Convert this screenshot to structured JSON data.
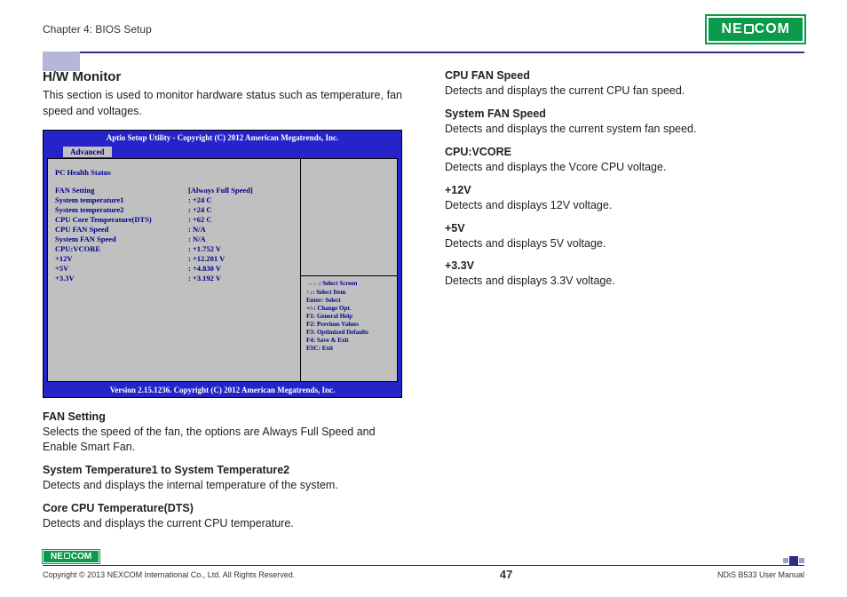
{
  "header": {
    "chapter": "Chapter 4: BIOS Setup",
    "logo_text_pre": "NE",
    "logo_text_post": "COM"
  },
  "left": {
    "title": "H/W Monitor",
    "intro": "This section is used to monitor hardware status such as temperature, fan speed and voltages.",
    "fan_setting": {
      "title": "FAN Setting",
      "desc": "Selects the speed of the fan, the options are Always Full Speed and Enable Smart Fan."
    },
    "systemp": {
      "title": "System Temperature1 to System Temperature2",
      "desc": "Detects and displays the internal temperature of the system."
    },
    "core": {
      "title": "Core CPU Temperature(DTS)",
      "desc": "Detects and displays the current CPU temperature."
    }
  },
  "bios": {
    "top": "Aptio Setup Utility - Copyright (C) 2012 American Megatrends, Inc.",
    "tab": "Advanced",
    "health": "PC Health Status",
    "rows": [
      {
        "k": "FAN Setting",
        "v": "[Always Full Speed]"
      },
      {
        "k": "System temperature1",
        "v": ": +24 C"
      },
      {
        "k": "System temperature2",
        "v": ": +24 C"
      },
      {
        "k": "CPU Core Temperature(DTS)",
        "v": ": +62 C"
      },
      {
        "k": "CPU FAN Speed",
        "v": ": N/A"
      },
      {
        "k": "System FAN Speed",
        "v": ": N/A"
      },
      {
        "k": "CPU:VCORE",
        "v": ": +1.752 V"
      },
      {
        "k": "+12V",
        "v": ": +12.201 V"
      },
      {
        "k": "+5V",
        "v": ": +4.830 V"
      },
      {
        "k": "+3.3V",
        "v": ": +3.192 V"
      }
    ],
    "help": [
      "→←: Select Screen",
      "↑↓: Select Item",
      "Enter: Select",
      "+/-: Change Opt.",
      "F1: General Help",
      "F2: Previous Values",
      "F3: Optimized Defaults",
      "F4: Save & Exit",
      "ESC: Exit"
    ],
    "bottom": "Version 2.15.1236. Copyright (C) 2012 American Megatrends, Inc."
  },
  "right": [
    {
      "title": "CPU FAN Speed",
      "desc": "Detects and displays the current CPU fan speed."
    },
    {
      "title": "System FAN Speed",
      "desc": "Detects and displays the current system fan speed."
    },
    {
      "title": "CPU:VCORE",
      "desc": "Detects and displays the Vcore CPU voltage."
    },
    {
      "title": "+12V",
      "desc": "Detects and displays 12V voltage."
    },
    {
      "title": "+5V",
      "desc": "Detects and displays 5V voltage."
    },
    {
      "title": "+3.3V",
      "desc": "Detects and displays 3.3V voltage."
    }
  ],
  "footer": {
    "copyright": "Copyright © 2013 NEXCOM International Co., Ltd. All Rights Reserved.",
    "page": "47",
    "doc": "NDiS B533 User Manual"
  }
}
